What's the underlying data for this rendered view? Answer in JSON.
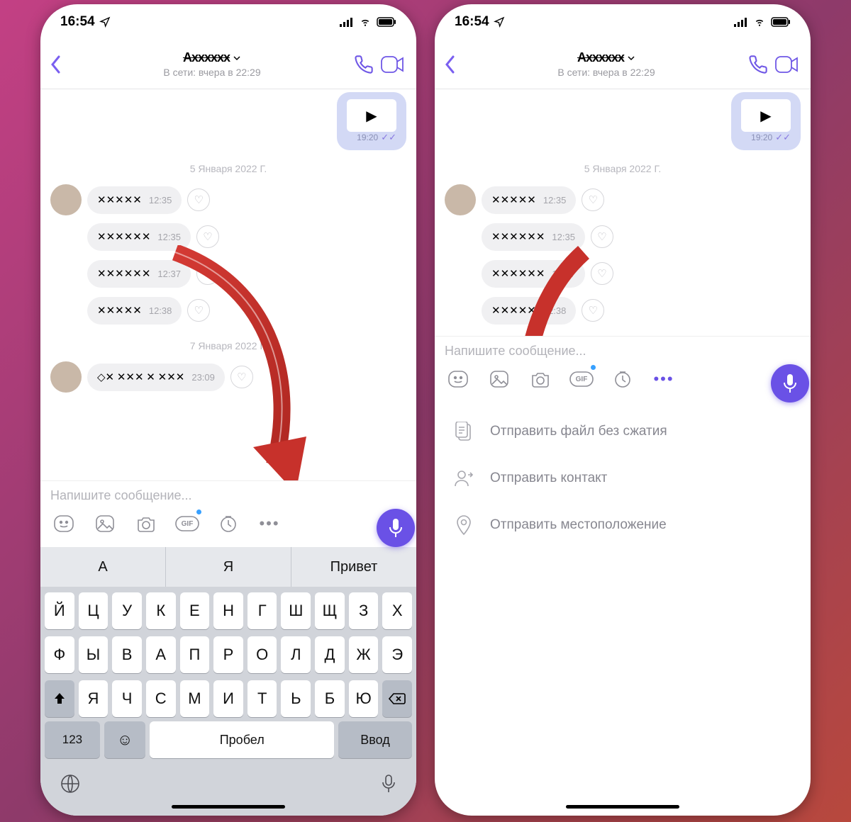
{
  "status": {
    "time": "16:54"
  },
  "header": {
    "contact_name": "(скрыто)",
    "subtitle": "В сети: вчера в 22:29"
  },
  "chat": {
    "out1_time": "19:20",
    "date1": "5 Января 2022 Г.",
    "in": [
      {
        "time": "12:35"
      },
      {
        "time": "12:35"
      },
      {
        "time": "12:37"
      },
      {
        "time": "12:38"
      }
    ],
    "date2": "7 Января 2022 Г.",
    "in5_time": "23:09"
  },
  "composer": {
    "placeholder": "Напишите сообщение..."
  },
  "suggestions": [
    "А",
    "Я",
    "Привет"
  ],
  "kb": {
    "row1": [
      "Й",
      "Ц",
      "У",
      "К",
      "Е",
      "Н",
      "Г",
      "Ш",
      "Щ",
      "З",
      "Х"
    ],
    "row2": [
      "Ф",
      "Ы",
      "В",
      "А",
      "П",
      "Р",
      "О",
      "Л",
      "Д",
      "Ж",
      "Э"
    ],
    "row3": [
      "Я",
      "Ч",
      "С",
      "М",
      "И",
      "Т",
      "Ь",
      "Б",
      "Ю"
    ],
    "num": "123",
    "space": "Пробел",
    "enter": "Ввод"
  },
  "more_menu": {
    "file": "Отправить файл без сжатия",
    "contact": "Отправить контакт",
    "location": "Отправить местоположение"
  }
}
